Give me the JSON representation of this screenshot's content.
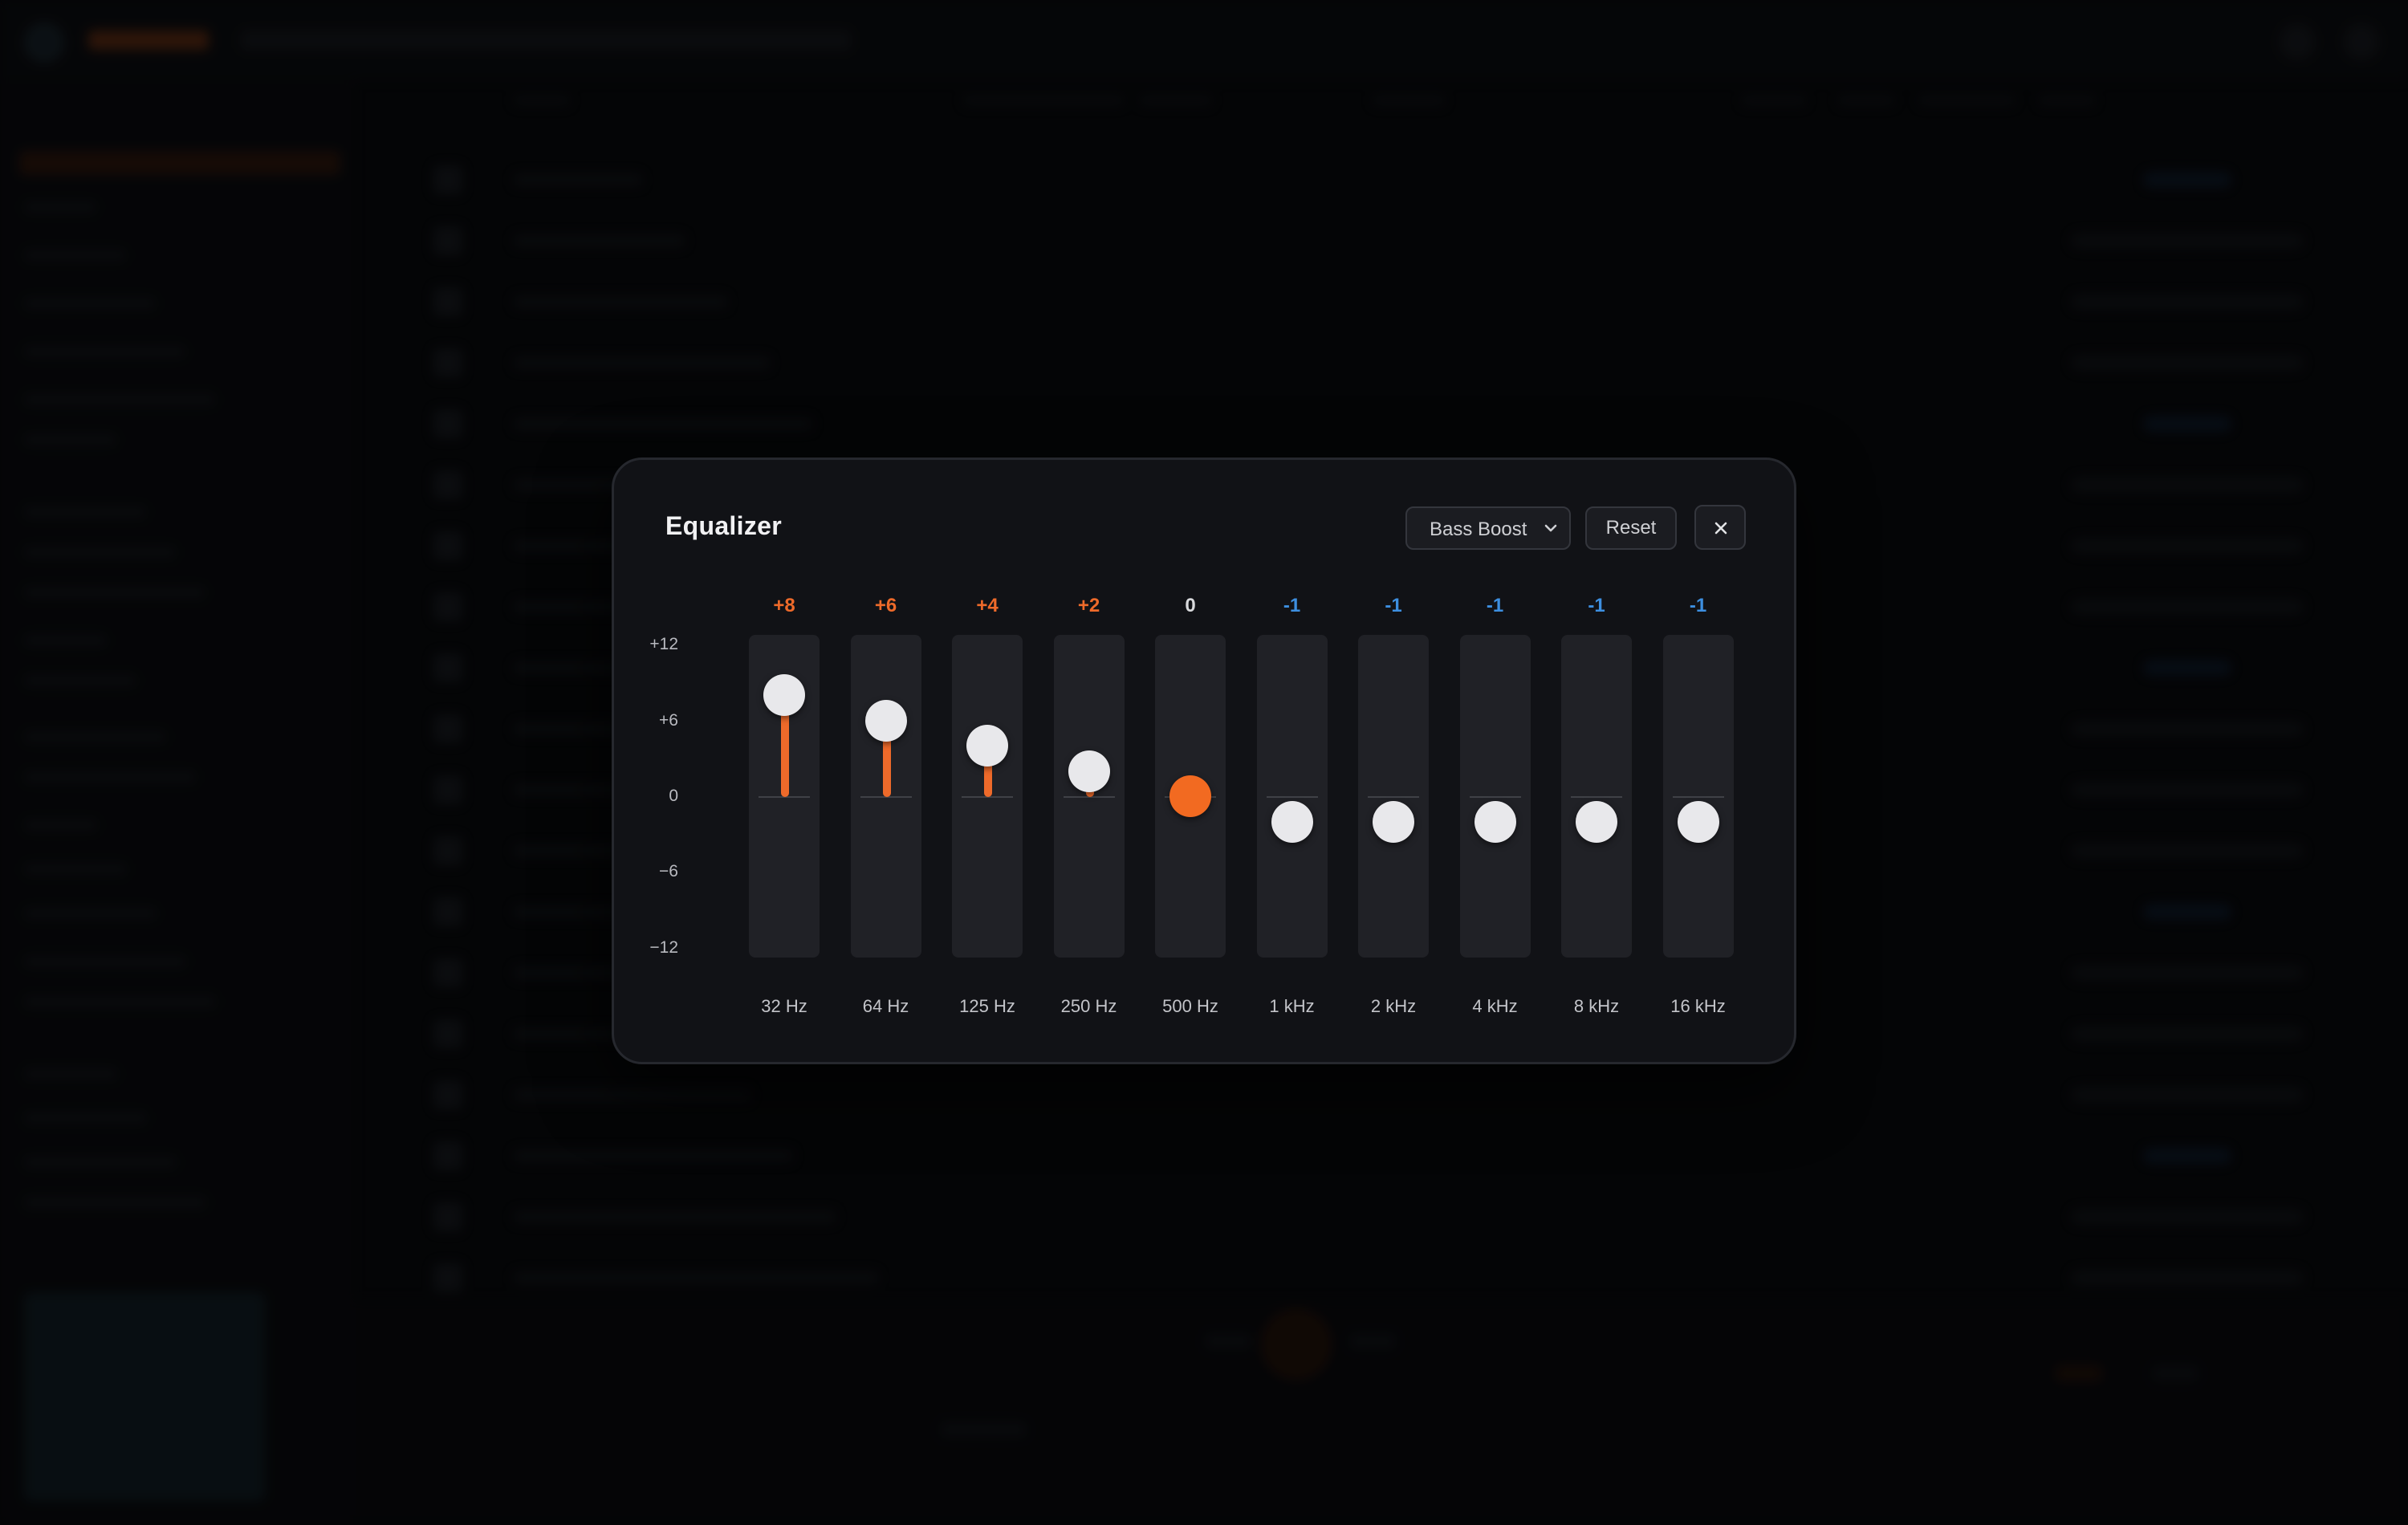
{
  "equalizer": {
    "title": "Equalizer",
    "preset": "Bass Boost",
    "reset_label": "Reset",
    "close_icon": "close-icon",
    "range": [
      -12,
      12
    ],
    "axis_ticks": [
      "+12",
      "+6",
      "0",
      "−6",
      "−12"
    ],
    "bands": [
      {
        "label": "32 Hz",
        "value_text": "+8",
        "gain": 8
      },
      {
        "label": "64 Hz",
        "value_text": "+6",
        "gain": 6
      },
      {
        "label": "125 Hz",
        "value_text": "+4",
        "gain": 4
      },
      {
        "label": "250 Hz",
        "value_text": "+2",
        "gain": 2
      },
      {
        "label": "500 Hz",
        "value_text": "0",
        "gain": 0,
        "active": true
      },
      {
        "label": "1 kHz",
        "value_text": "-1",
        "gain": -1
      },
      {
        "label": "2 kHz",
        "value_text": "-1",
        "gain": -1
      },
      {
        "label": "4 kHz",
        "value_text": "-1",
        "gain": -1
      },
      {
        "label": "8 kHz",
        "value_text": "-1",
        "gain": -1
      },
      {
        "label": "16 kHz",
        "value_text": "-1",
        "gain": -1
      }
    ],
    "colors": {
      "boost": "#ee6a2a",
      "cut": "#3d8fe0",
      "neutral": "#d8d9dc",
      "knob": "#e8e8eb",
      "active_knob": "#f26a21"
    }
  }
}
